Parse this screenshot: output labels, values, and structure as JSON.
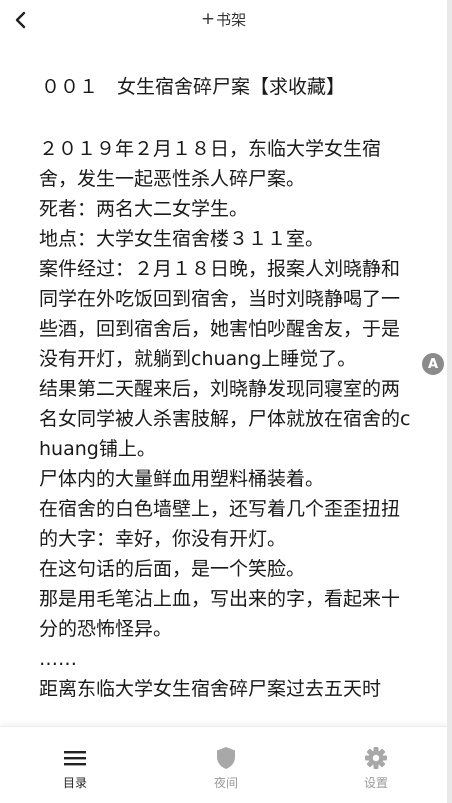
{
  "top_bar": {
    "back_icon": "chevron-left-icon",
    "bookshelf_plus": "+",
    "bookshelf_label": "书架"
  },
  "chapter": {
    "title": "００１　女生宿舍碎尸案【求收藏】",
    "paragraphs": [
      "２０１９年２月１８日，东临大学女生宿舍，发生一起恶性杀人碎尸案。",
      "死者：两名大二女学生。",
      "地点：大学女生宿舍楼３１１室。",
      "案件经过：２月１８日晚，报案人刘晓静和同学在外吃饭回到宿舍，当时刘晓静喝了一些酒，回到宿舍后，她害怕吵醒舍友，于是没有开灯，就躺到chuang上睡觉了。",
      "结果第二天醒来后，刘晓静发现同寝室的两名女同学被人杀害肢解，尸体就放在宿舍的chuang铺上。",
      "尸体内的大量鲜血用塑料桶装着。",
      "在宿舍的白色墙壁上，还写着几个歪歪扭扭的大字：幸好，你没有开灯。",
      "在这句话的后面，是一个笑脸。",
      "那是用毛笔沾上血，写出来的字，看起来十分的恐怖怪异。",
      "……",
      "距离东临大学女生宿舍碎尸案过去五天时"
    ]
  },
  "float_button": {
    "label": "A"
  },
  "bottom_nav": {
    "items": [
      {
        "label": "目录",
        "icon": "menu-icon",
        "active": true
      },
      {
        "label": "夜间",
        "icon": "night-shield-icon",
        "active": false
      },
      {
        "label": "设置",
        "icon": "gear-icon",
        "active": false
      }
    ]
  },
  "colors": {
    "text": "#1a1a1a",
    "nav_active": "#222222",
    "nav_inactive": "#9a9a9a",
    "float_button": "#8b8b8b"
  }
}
